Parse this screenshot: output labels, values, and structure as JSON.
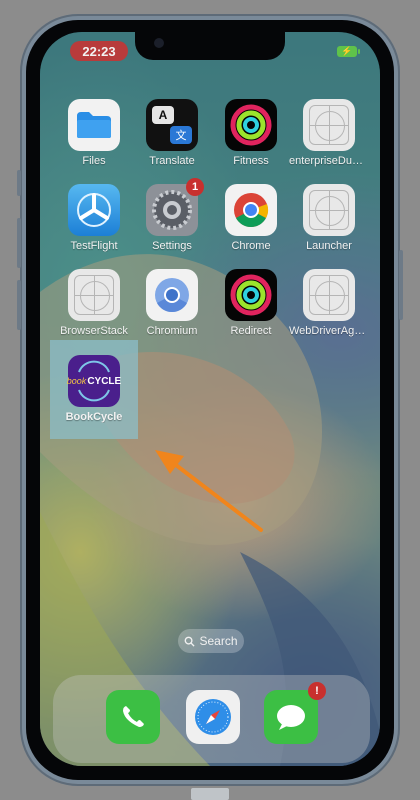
{
  "status_bar": {
    "time": "22:23",
    "battery_glyph": "⚡"
  },
  "apps": {
    "files": {
      "label": "Files"
    },
    "translate": {
      "label": "Translate",
      "glyph_a": "A",
      "glyph_zh": "文"
    },
    "fitness": {
      "label": "Fitness"
    },
    "enterprise": {
      "label": "enterpriseDum..."
    },
    "testflight": {
      "label": "TestFlight"
    },
    "settings": {
      "label": "Settings",
      "badge": "1"
    },
    "chrome": {
      "label": "Chrome"
    },
    "launcher": {
      "label": "Launcher"
    },
    "browserstack": {
      "label": "BrowserStack"
    },
    "chromium": {
      "label": "Chromium"
    },
    "redirect": {
      "label": "Redirect"
    },
    "webdriveragent": {
      "label": "WebDriverAge..."
    },
    "bookcycle": {
      "label": "BookCycle",
      "logo_book": "book",
      "logo_cycle": "CYCLE"
    }
  },
  "search": {
    "label": "Search"
  },
  "dock": {
    "messages_badge": "!"
  },
  "colors": {
    "arrow": "#f0851c",
    "highlight": "#8cbec8",
    "badge": "#c8302e"
  }
}
